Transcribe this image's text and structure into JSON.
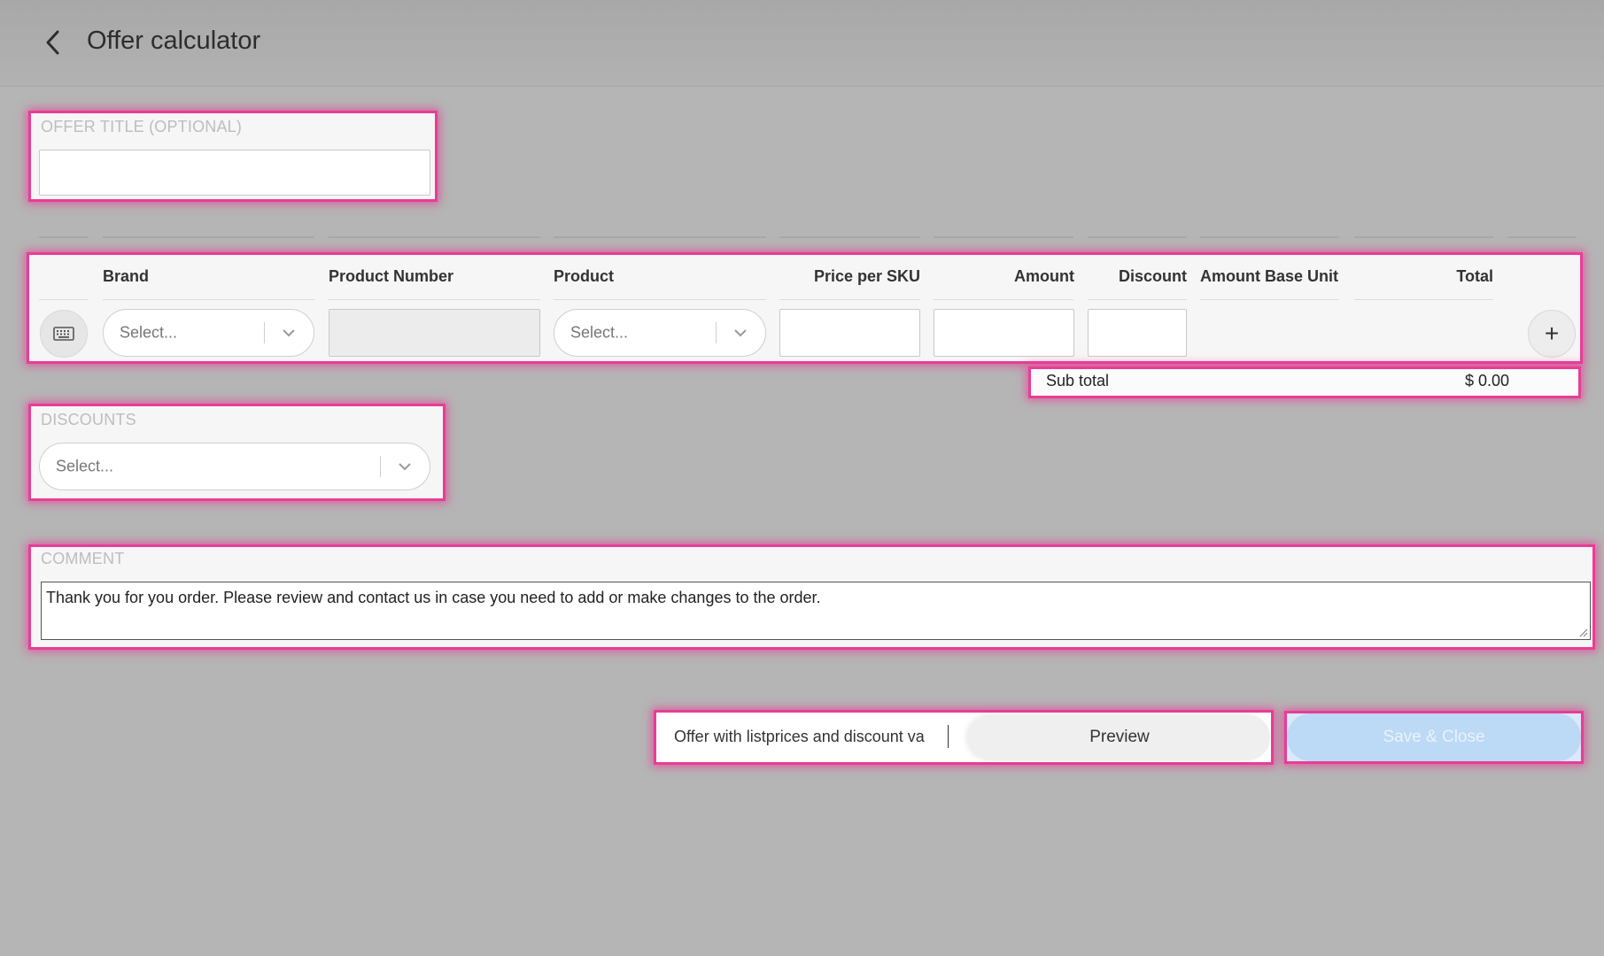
{
  "header": {
    "title": "Offer calculator"
  },
  "offer_title": {
    "label": "OFFER TITLE (OPTIONAL)",
    "value": ""
  },
  "table": {
    "columns": [
      "Brand",
      "Product Number",
      "Product",
      "Price per SKU",
      "Amount",
      "Discount",
      "Amount Base Unit",
      "Total"
    ],
    "row": {
      "brand_placeholder": "Select...",
      "product_placeholder": "Select...",
      "add_label": "+"
    }
  },
  "subtotal": {
    "label": "Sub total",
    "value": "$ 0.00"
  },
  "discounts": {
    "label": "DISCOUNTS",
    "placeholder": "Select..."
  },
  "comment": {
    "label": "COMMENT",
    "value": "Thank you for you order. Please review and contact us in case you need to add or make changes to the order."
  },
  "footer": {
    "offer_type_value": "Offer with listprices and discount va",
    "preview_label": "Preview",
    "save_label": "Save & Close"
  },
  "colors": {
    "highlight": "#e83d96",
    "save_button": "#bcd9f5"
  },
  "icons": [
    "back-arrow-icon",
    "keyboard-icon",
    "chevron-down-icon",
    "plus-icon",
    "resize-grip-icon"
  ]
}
